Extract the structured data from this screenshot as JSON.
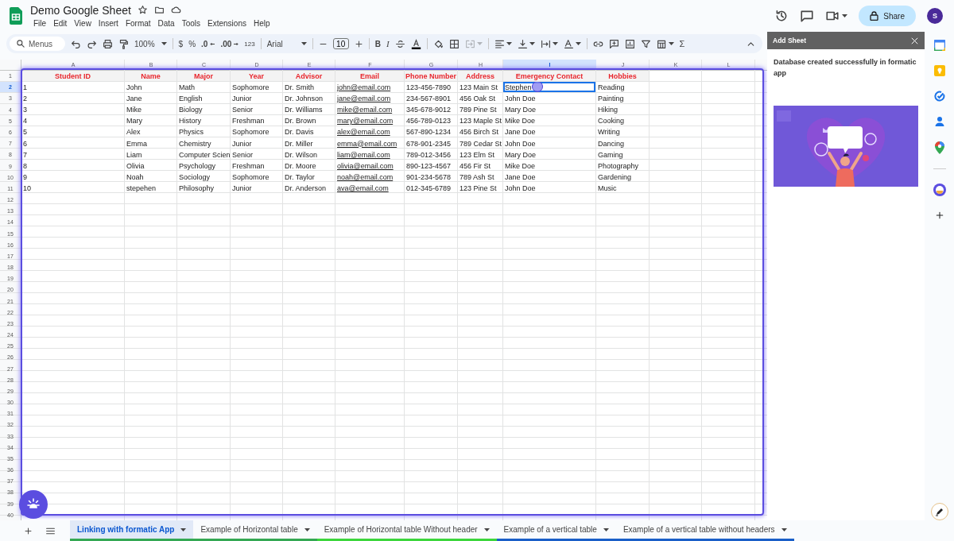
{
  "document": {
    "title": "Demo Google Sheet"
  },
  "menu": [
    "File",
    "Edit",
    "View",
    "Insert",
    "Format",
    "Data",
    "Tools",
    "Extensions",
    "Help"
  ],
  "share": {
    "label": "Share"
  },
  "avatar": {
    "initial": "S"
  },
  "toolbar": {
    "search_placeholder": "Menus",
    "zoom": "100%",
    "currency": "$",
    "percent": "%",
    "decimal_decrease": ".0",
    "decimal_increase": ".00",
    "number_format": "123",
    "font": "Arial",
    "font_size": "10",
    "bold": "B",
    "italic": "I",
    "merge_disabled": true,
    "sum": "Σ"
  },
  "sheet": {
    "columns": [
      {
        "letter": "A",
        "selected": false
      },
      {
        "letter": "B",
        "selected": false
      },
      {
        "letter": "C",
        "selected": false
      },
      {
        "letter": "D",
        "selected": false
      },
      {
        "letter": "E",
        "selected": false
      },
      {
        "letter": "F",
        "selected": false
      },
      {
        "letter": "G",
        "selected": false
      },
      {
        "letter": "H",
        "selected": false
      },
      {
        "letter": "I",
        "selected": true
      },
      {
        "letter": "J",
        "selected": false
      },
      {
        "letter": "K",
        "selected": false
      },
      {
        "letter": "L",
        "selected": false
      }
    ],
    "header_row": {
      "number": "1",
      "selected": false
    },
    "fields": [
      {
        "header": "Student ID",
        "kind": "text"
      },
      {
        "header": "Name",
        "kind": "text"
      },
      {
        "header": "Major",
        "kind": "text"
      },
      {
        "header": "Year",
        "kind": "text"
      },
      {
        "header": "Advisor",
        "kind": "text"
      },
      {
        "header": "Email",
        "kind": "link"
      },
      {
        "header": "Phone Number",
        "kind": "text"
      },
      {
        "header": "Address",
        "kind": "text"
      },
      {
        "header": "Emergency Contact",
        "kind": "text"
      },
      {
        "header": "Hobbies",
        "kind": "text"
      }
    ],
    "rows": [
      {
        "number": "2",
        "selected": true,
        "cells": [
          "1",
          "John",
          "Math",
          "Sophomore",
          "Dr. Smith",
          "john@email.com",
          "123-456-7890",
          "123 Main St",
          "Stephen",
          "Reading"
        ]
      },
      {
        "number": "3",
        "selected": false,
        "cells": [
          "2",
          "Jane",
          "English",
          "Junior",
          "Dr. Johnson",
          "jane@email.com",
          "234-567-8901",
          "456 Oak St",
          "John Doe",
          "Painting"
        ]
      },
      {
        "number": "4",
        "selected": false,
        "cells": [
          "3",
          "Mike",
          "Biology",
          "Senior",
          "Dr. Williams",
          "mike@email.com",
          "345-678-9012",
          "789 Pine St",
          "Mary Doe",
          "Hiking"
        ]
      },
      {
        "number": "5",
        "selected": false,
        "cells": [
          "4",
          "Mary",
          "History",
          "Freshman",
          "Dr. Brown",
          "mary@email.com",
          "456-789-0123",
          "123 Maple St",
          "Mike Doe",
          "Cooking"
        ]
      },
      {
        "number": "6",
        "selected": false,
        "cells": [
          "5",
          "Alex",
          "Physics",
          "Sophomore",
          "Dr. Davis",
          "alex@email.com",
          "567-890-1234",
          "456 Birch St",
          "Jane Doe",
          "Writing"
        ]
      },
      {
        "number": "7",
        "selected": false,
        "cells": [
          "6",
          "Emma",
          "Chemistry",
          "Junior",
          "Dr. Miller",
          "emma@email.com",
          "678-901-2345",
          "789 Cedar St",
          "John Doe",
          "Dancing"
        ]
      },
      {
        "number": "8",
        "selected": false,
        "cells": [
          "7",
          "Liam",
          "Computer Scien",
          "Senior",
          "Dr. Wilson",
          "liam@email.com",
          "789-012-3456",
          "123 Elm St",
          "Mary Doe",
          "Gaming"
        ]
      },
      {
        "number": "9",
        "selected": false,
        "cells": [
          "8",
          "Olivia",
          "Psychology",
          "Freshman",
          "Dr. Moore",
          "olivia@email.com",
          "890-123-4567",
          "456 Fir St",
          "Mike Doe",
          "Photography"
        ]
      },
      {
        "number": "10",
        "selected": false,
        "cells": [
          "9",
          "Noah",
          "Sociology",
          "Sophomore",
          "Dr. Taylor",
          "noah@email.com",
          "901-234-5678",
          "789 Ash St",
          "Jane Doe",
          "Gardening"
        ]
      },
      {
        "number": "11",
        "selected": false,
        "cells": [
          "10",
          "stepehen",
          "Philosophy",
          "Junior",
          "Dr. Anderson",
          "ava@email.com",
          "012-345-6789",
          "123 Pine St",
          "John Doe",
          "Music"
        ]
      }
    ],
    "empty_rows": [
      "12",
      "13",
      "14",
      "15",
      "16",
      "17",
      "18",
      "19",
      "20",
      "21",
      "22",
      "23",
      "24",
      "25",
      "26",
      "27",
      "28",
      "29",
      "30",
      "31",
      "32",
      "33",
      "34",
      "35",
      "36",
      "37",
      "38",
      "39",
      "40"
    ]
  },
  "sheet_tabs": [
    {
      "label": "Linking with formatic App",
      "selected": true,
      "color": "#34a853"
    },
    {
      "label": "Example of Horizontal table",
      "selected": false,
      "color": "#34a853"
    },
    {
      "label": "Example of Horizontal table Without header",
      "selected": false,
      "color": "#3cd63c"
    },
    {
      "label": "Example of a vertical table",
      "selected": false,
      "color": "#1a5fc8"
    },
    {
      "label": "Example of a vertical table without headers",
      "selected": false,
      "color": "#1a5fc8"
    }
  ],
  "side_panel": {
    "title": "Add Sheet",
    "message": "Database created successfully in formatic app"
  }
}
